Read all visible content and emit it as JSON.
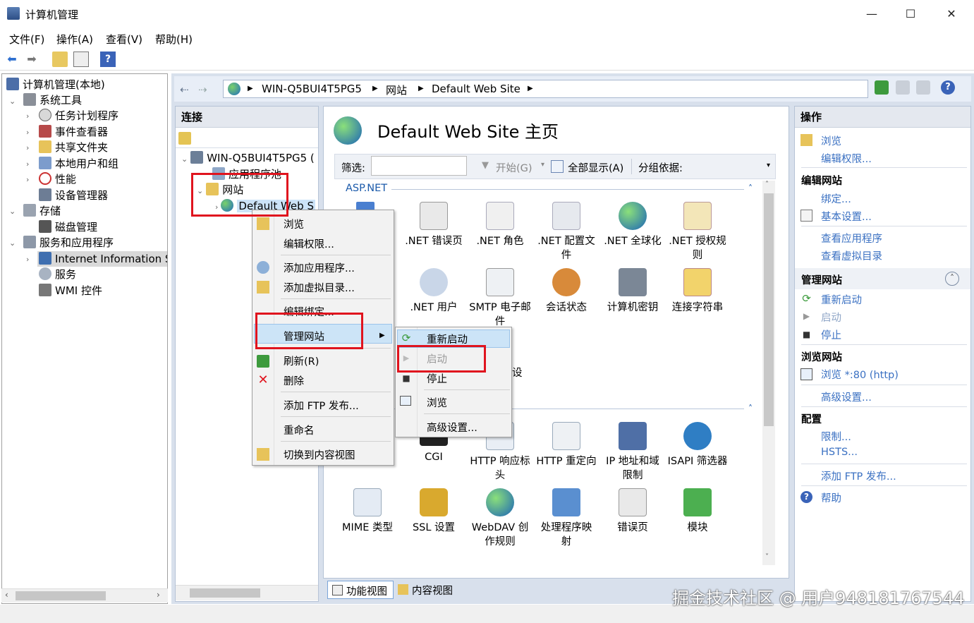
{
  "window": {
    "title": "计算机管理",
    "min": "—",
    "max": "☐",
    "close": "✕"
  },
  "menubar": [
    "文件(F)",
    "操作(A)",
    "查看(V)",
    "帮助(H)"
  ],
  "tree": {
    "root": "计算机管理(本地)",
    "items": [
      "系统工具",
      "任务计划程序",
      "事件查看器",
      "共享文件夹",
      "本地用户和组",
      "性能",
      "设备管理器",
      "存储",
      "磁盘管理",
      "服务和应用程序",
      "Internet Information Se",
      "服务",
      "WMI 控件"
    ]
  },
  "address": {
    "crumbs": [
      "WIN-Q5BUI4T5PG5",
      "网站",
      "Default Web Site"
    ]
  },
  "connections": {
    "header": "连接",
    "server": "WIN-Q5BUI4T5PG5 (",
    "apppools": "应用程序池",
    "sites": "网站",
    "site": "Default Web S"
  },
  "main": {
    "title": "Default Web Site 主页",
    "filter_label": "筛选:",
    "start": "开始(G)",
    "show_all": "全部显示(A)",
    "group_by": "分组依据:",
    "group_aspnet": "ASP.NET",
    "features_row1": [
      ".NET 错误页",
      ".NET 角色",
      ".NET 配置文\n件",
      ".NET 全球化",
      ".NET 授权规\n则"
    ],
    "features_row2": [
      ".NET 用户",
      "SMTP 电子邮\n件",
      "会话状态",
      "计算机密钥",
      "连接字符串"
    ],
    "partial_label": "设",
    "features_row3": [
      "CGI",
      "HTTP 响应标\n头",
      "HTTP 重定向",
      "IP 地址和域\n限制",
      "ISAPI 筛选器"
    ],
    "features_row4": [
      "MIME 类型",
      "SSL 设置",
      "WebDAV 创\n作规则",
      "处理程序映\n射",
      "错误页",
      "模块"
    ],
    "tab_features": "功能视图",
    "tab_content": "内容视图"
  },
  "actions": {
    "header": "操作",
    "browse": "浏览",
    "edit_perms": "编辑权限...",
    "edit_site": "编辑网站",
    "bindings": "绑定...",
    "basic": "基本设置...",
    "view_apps": "查看应用程序",
    "view_vdirs": "查看虚拟目录",
    "manage_site": "管理网站",
    "restart": "重新启动",
    "start": "启动",
    "stop": "停止",
    "browse_site": "浏览网站",
    "browse80": "浏览 *:80 (http)",
    "advanced": "高级设置...",
    "config": "配置",
    "limits": "限制...",
    "hsts": "HSTS...",
    "add_ftp": "添加 FTP 发布...",
    "help": "帮助"
  },
  "context_menu": {
    "items": [
      "浏览",
      "编辑权限...",
      "添加应用程序...",
      "添加虚拟目录...",
      "编辑绑定...",
      "管理网站",
      "刷新(R)",
      "删除",
      "添加 FTP 发布...",
      "重命名",
      "切换到内容视图"
    ],
    "submenu": [
      "重新启动",
      "启动",
      "停止",
      "浏览",
      "高级设置..."
    ]
  },
  "watermark": "掘金技术社区 @ 用户948181767544"
}
